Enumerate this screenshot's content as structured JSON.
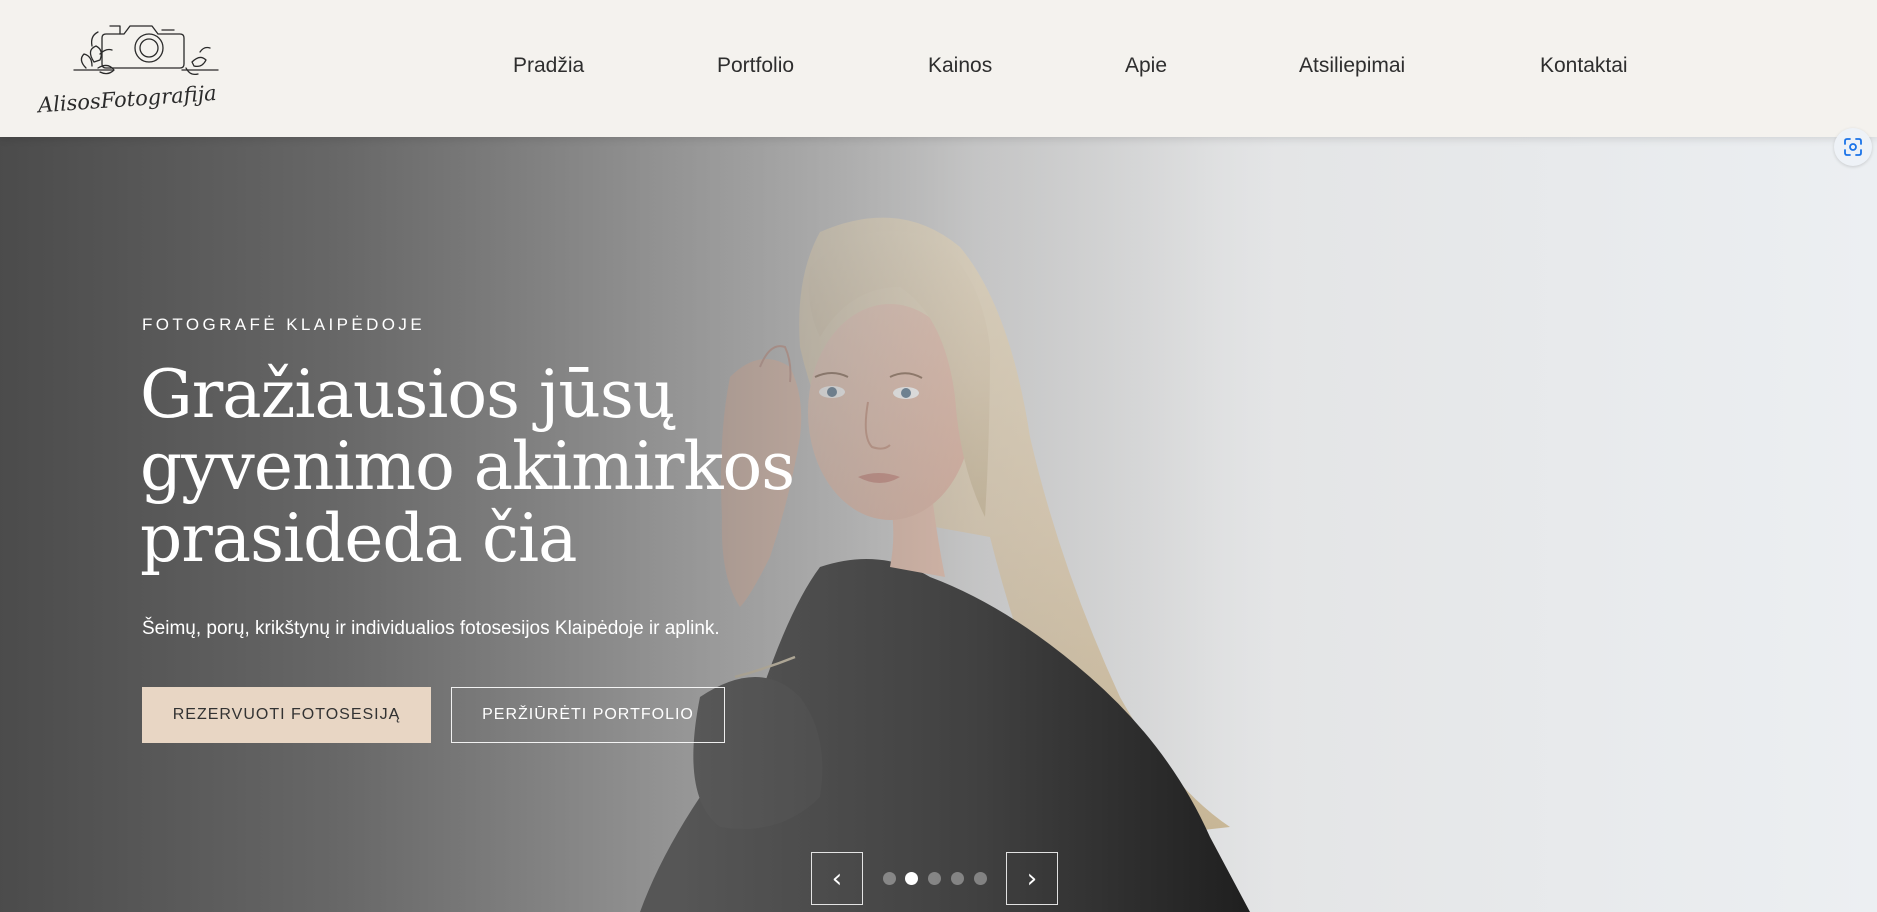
{
  "header": {
    "logo_text": "AlisosFotografija",
    "nav": [
      {
        "label": "Pradžia"
      },
      {
        "label": "Portfolio"
      },
      {
        "label": "Kainos"
      },
      {
        "label": "Apie"
      },
      {
        "label": "Atsiliepimai"
      },
      {
        "label": "Kontaktai"
      }
    ]
  },
  "hero": {
    "eyebrow": "FOTOGRAFĖ KLAIPĖDOJE",
    "title_lines": [
      "Gražiausios jūsų",
      "gyvenimo akimirkos",
      "prasideda čia"
    ],
    "subtitle": "Šeimų, porų, krikštynų ir individualios fotosesijos Klaipėdoje ir aplink.",
    "primary_button": "REZERVUOTI FOTOSESIJĄ",
    "secondary_button": "PERŽIŪRĖTI PORTFOLIO",
    "slider": {
      "prev_glyph": "‹",
      "next_glyph": "›",
      "dot_count": 5,
      "active_index": 1
    }
  },
  "icons": {
    "lens": "google-lens-icon",
    "logo": "camera-flowers-logo"
  },
  "colors": {
    "header_bg": "#f4f2ee",
    "nav_text": "#2e2e2e",
    "primary_button_bg": "#e8d6c4",
    "hero_text": "#ffffff"
  }
}
